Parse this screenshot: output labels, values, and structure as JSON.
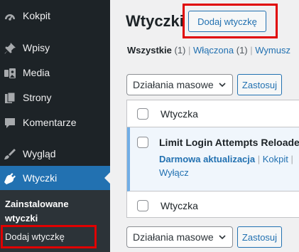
{
  "sidebar": {
    "items": [
      {
        "label": "Kokpit",
        "icon": "dashboard-icon"
      },
      {
        "label": "Wpisy",
        "icon": "pushpin-icon"
      },
      {
        "label": "Media",
        "icon": "media-icon"
      },
      {
        "label": "Strony",
        "icon": "page-icon"
      },
      {
        "label": "Komentarze",
        "icon": "comment-icon"
      },
      {
        "label": "Wygląd",
        "icon": "brush-icon"
      },
      {
        "label": "Wtyczki",
        "icon": "plugin-icon"
      }
    ],
    "submenu": {
      "current_line1": "Zainstalowane",
      "current_line2": "wtyczki",
      "add_new": "Dodaj wtyczkę"
    }
  },
  "header": {
    "title": "Wtyczki",
    "add_new_button": "Dodaj wtyczkę"
  },
  "filters": {
    "all_label": "Wszystkie",
    "all_count": "(1)",
    "active_label": "Włączona",
    "active_count": "(1)",
    "mustuse_label": "Wymusz"
  },
  "bulk": {
    "select_value": "Działania masowe",
    "apply_label": "Zastosuj"
  },
  "table": {
    "column_header": "Wtyczka",
    "plugin": {
      "name": "Limit Login Attempts Reloade",
      "update_link": "Darmowa aktualizacja",
      "dashboard_link": "Kokpit",
      "deactivate_link": "Wyłącz"
    },
    "column_footer": "Wtyczka"
  },
  "colors": {
    "sidebar_bg": "#1d2327",
    "accent": "#2271b1",
    "highlight": "#e00000"
  }
}
